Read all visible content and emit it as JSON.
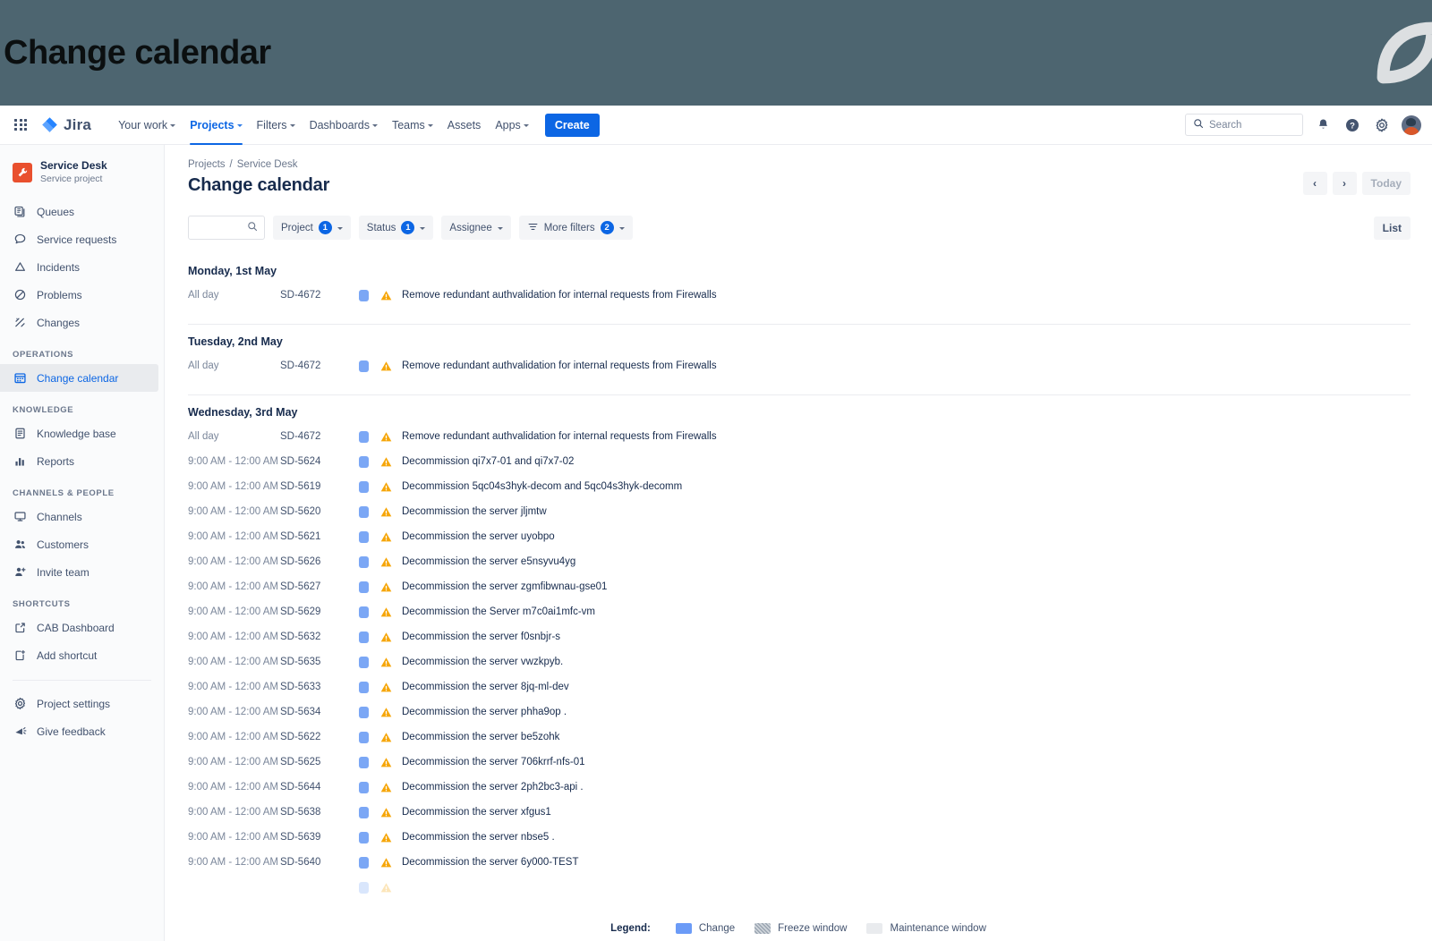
{
  "banner": {
    "title": "Change calendar",
    "bg_color": "#4d6570",
    "logo_icon": "leaf-logo"
  },
  "topnav": {
    "app_switcher_icon": "app-grid-icon",
    "brand": "Jira",
    "items": [
      {
        "label": "Your work",
        "has_caret": true,
        "active": false
      },
      {
        "label": "Projects",
        "has_caret": true,
        "active": true
      },
      {
        "label": "Filters",
        "has_caret": true,
        "active": false
      },
      {
        "label": "Dashboards",
        "has_caret": true,
        "active": false
      },
      {
        "label": "Teams",
        "has_caret": true,
        "active": false
      },
      {
        "label": "Assets",
        "has_caret": false,
        "active": false
      },
      {
        "label": "Apps",
        "has_caret": true,
        "active": false
      }
    ],
    "create_label": "Create",
    "create_color": "#0c66e4",
    "search": {
      "placeholder": "Search",
      "value": "",
      "icon": "search-icon"
    },
    "right_icons": [
      "notifications-icon",
      "help-icon",
      "settings-gear-icon",
      "avatar"
    ]
  },
  "sidebar": {
    "project": {
      "name": "Service Desk",
      "type": "Service project",
      "avatar_icon": "wrench-icon",
      "avatar_color": "#e9502e"
    },
    "items": [
      {
        "label": "Queues",
        "icon": "queues-icon",
        "selected": false
      },
      {
        "label": "Service requests",
        "icon": "chat-bubble-icon",
        "selected": false
      },
      {
        "label": "Incidents",
        "icon": "warning-triangle-icon",
        "selected": false
      },
      {
        "label": "Problems",
        "icon": "no-entry-icon",
        "selected": false
      },
      {
        "label": "Changes",
        "icon": "shuffle-arrows-icon",
        "selected": false
      }
    ],
    "groups": [
      {
        "title": "OPERATIONS",
        "items": [
          {
            "label": "Change calendar",
            "icon": "calendar-icon",
            "selected": true
          }
        ]
      },
      {
        "title": "KNOWLEDGE",
        "items": [
          {
            "label": "Knowledge base",
            "icon": "book-icon",
            "selected": false
          },
          {
            "label": "Reports",
            "icon": "bar-chart-icon",
            "selected": false
          }
        ]
      },
      {
        "title": "CHANNELS & PEOPLE",
        "items": [
          {
            "label": "Channels",
            "icon": "monitor-icon",
            "selected": false
          },
          {
            "label": "Customers",
            "icon": "people-icon",
            "selected": false
          },
          {
            "label": "Invite team",
            "icon": "person-add-icon",
            "selected": false
          }
        ]
      },
      {
        "title": "SHORTCUTS",
        "items": [
          {
            "label": "CAB Dashboard",
            "icon": "external-link-icon",
            "selected": false
          },
          {
            "label": "Add shortcut",
            "icon": "add-page-icon",
            "selected": false
          }
        ]
      }
    ],
    "footer_items": [
      {
        "label": "Project settings",
        "icon": "settings-gear-icon"
      },
      {
        "label": "Give feedback",
        "icon": "megaphone-icon"
      }
    ]
  },
  "page": {
    "breadcrumb": [
      "Projects",
      "Service Desk"
    ],
    "breadcrumb_separator": "/",
    "title": "Change calendar",
    "prev_label": "‹",
    "next_label": "›",
    "today_label": "Today",
    "view_label": "List"
  },
  "filters": {
    "search": {
      "value": "",
      "placeholder": "",
      "icon": "search-icon"
    },
    "chips": [
      {
        "label": "Project",
        "count": "1",
        "icon": null
      },
      {
        "label": "Status",
        "count": "1",
        "icon": null
      },
      {
        "label": "Assignee",
        "count": null,
        "icon": null
      },
      {
        "label": "More filters",
        "count": "2",
        "icon": "filter-icon"
      }
    ]
  },
  "calendar": {
    "days": [
      {
        "title": "Monday, 1st May",
        "events": [
          {
            "time": "All day",
            "key": "SD-4672",
            "summary": "Remove redundant authvalidation for internal requests from Firewalls",
            "type": "change",
            "risk": "warning"
          }
        ]
      },
      {
        "title": "Tuesday, 2nd May",
        "events": [
          {
            "time": "All day",
            "key": "SD-4672",
            "summary": "Remove redundant authvalidation for internal requests from Firewalls",
            "type": "change",
            "risk": "warning"
          }
        ]
      },
      {
        "title": "Wednesday, 3rd May",
        "events": [
          {
            "time": "All day",
            "key": "SD-4672",
            "summary": "Remove redundant authvalidation for internal requests from Firewalls",
            "type": "change",
            "risk": "warning"
          },
          {
            "time": "9:00 AM - 12:00 AM",
            "key": "SD-5624",
            "summary": "Decommission qi7x7-01 and qi7x7-02",
            "type": "change",
            "risk": "warning"
          },
          {
            "time": "9:00 AM - 12:00 AM",
            "key": "SD-5619",
            "summary": "Decommission 5qc04s3hyk-decom and 5qc04s3hyk-decomm",
            "type": "change",
            "risk": "warning"
          },
          {
            "time": "9:00 AM - 12:00 AM",
            "key": "SD-5620",
            "summary": "Decommission the server jljmtw",
            "type": "change",
            "risk": "warning"
          },
          {
            "time": "9:00 AM - 12:00 AM",
            "key": "SD-5621",
            "summary": "Decommission the server uyobpo",
            "type": "change",
            "risk": "warning"
          },
          {
            "time": "9:00 AM - 12:00 AM",
            "key": "SD-5626",
            "summary": "Decommission the server e5nsyvu4yg",
            "type": "change",
            "risk": "warning"
          },
          {
            "time": "9:00 AM - 12:00 AM",
            "key": "SD-5627",
            "summary": "Decommission the server zgmfibwnau-gse01",
            "type": "change",
            "risk": "warning"
          },
          {
            "time": "9:00 AM - 12:00 AM",
            "key": "SD-5629",
            "summary": "Decommission the Server m7c0ai1mfc-vm",
            "type": "change",
            "risk": "warning"
          },
          {
            "time": "9:00 AM - 12:00 AM",
            "key": "SD-5632",
            "summary": "Decommission the server f0snbjr-s",
            "type": "change",
            "risk": "warning"
          },
          {
            "time": "9:00 AM - 12:00 AM",
            "key": "SD-5635",
            "summary": "Decommission the server vwzkpyb.",
            "type": "change",
            "risk": "warning"
          },
          {
            "time": "9:00 AM - 12:00 AM",
            "key": "SD-5633",
            "summary": "Decommission the server 8jq-ml-dev",
            "type": "change",
            "risk": "warning"
          },
          {
            "time": "9:00 AM - 12:00 AM",
            "key": "SD-5634",
            "summary": "Decommission the server phha9op .",
            "type": "change",
            "risk": "warning"
          },
          {
            "time": "9:00 AM - 12:00 AM",
            "key": "SD-5622",
            "summary": "Decommission the server be5zohk",
            "type": "change",
            "risk": "warning"
          },
          {
            "time": "9:00 AM - 12:00 AM",
            "key": "SD-5625",
            "summary": "Decommission the server 706krrf-nfs-01",
            "type": "change",
            "risk": "warning"
          },
          {
            "time": "9:00 AM - 12:00 AM",
            "key": "SD-5644",
            "summary": "Decommission the server 2ph2bc3-api .",
            "type": "change",
            "risk": "warning"
          },
          {
            "time": "9:00 AM - 12:00 AM",
            "key": "SD-5638",
            "summary": "Decommission the server xfgus1",
            "type": "change",
            "risk": "warning"
          },
          {
            "time": "9:00 AM - 12:00 AM",
            "key": "SD-5639",
            "summary": "Decommission the server nbse5 .",
            "type": "change",
            "risk": "warning"
          },
          {
            "time": "9:00 AM - 12:00 AM",
            "key": "SD-5640",
            "summary": "Decommission the server 6y000-TEST",
            "type": "change",
            "risk": "warning"
          }
        ]
      }
    ]
  },
  "legend": {
    "label": "Legend:",
    "items": [
      {
        "label": "Change",
        "color": "#6b9bf7",
        "swatch": "sw-change"
      },
      {
        "label": "Freeze window",
        "color": "#9aa5b1",
        "swatch": "sw-freeze"
      },
      {
        "label": "Maintenance window",
        "color": "#e9ebee",
        "swatch": "sw-maint"
      }
    ]
  }
}
